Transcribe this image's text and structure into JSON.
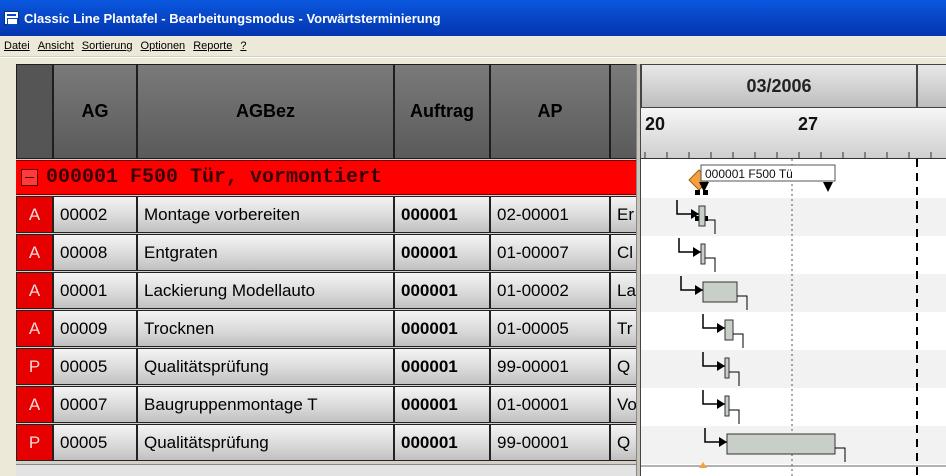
{
  "window": {
    "title": "Classic Line Plantafel  - Bearbeitungsmodus - Vorwärtsterminierung"
  },
  "menu": [
    "Datei",
    "Ansicht",
    "Sortierung",
    "Optionen",
    "Reporte",
    "?"
  ],
  "grid": {
    "columns": [
      "",
      "AG",
      "AGBez",
      "Auftrag",
      "AP",
      ""
    ],
    "group": {
      "label": "000001 F500 Tür, vormontiert"
    },
    "rows": [
      {
        "type": "A",
        "ag": "00002",
        "agbez": "Montage vorbereiten",
        "auftrag": "000001",
        "ap": "02-00001",
        "extra": "Er"
      },
      {
        "type": "A",
        "ag": "00008",
        "agbez": "Entgraten",
        "auftrag": "000001",
        "ap": "01-00007",
        "extra": "Cl"
      },
      {
        "type": "A",
        "ag": "00001",
        "agbez": "Lackierung Modellauto",
        "auftrag": "000001",
        "ap": "01-00002",
        "extra": "La"
      },
      {
        "type": "A",
        "ag": "00009",
        "agbez": "Trocknen",
        "auftrag": "000001",
        "ap": "01-00005",
        "extra": "Tr"
      },
      {
        "type": "P",
        "ag": "00005",
        "agbez": "Qualitätsprüfung",
        "auftrag": "000001",
        "ap": "99-00001",
        "extra": "Q"
      },
      {
        "type": "A",
        "ag": "00007",
        "agbez": "Baugruppenmontage T",
        "auftrag": "000001",
        "ap": "01-00001",
        "extra": "Vo"
      },
      {
        "type": "P",
        "ag": "00005",
        "agbez": "Qualitätsprüfung",
        "auftrag": "000001",
        "ap": "99-00001",
        "extra": "Q"
      }
    ]
  },
  "gantt": {
    "month": "03/2006",
    "days": [
      "20",
      "27"
    ],
    "order_label": "000001 F500 Tü"
  },
  "colors": {
    "title_blue": "#0747c8",
    "group_red": "#ff0000",
    "type_red": "#e60000",
    "bar_fill": "#c8cfc8",
    "milestone": "#f5a040"
  }
}
